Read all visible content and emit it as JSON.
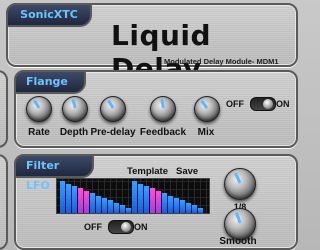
{
  "brand": "SonicXTC",
  "title": "Liquid Delay",
  "subtitle": "Modulated Delay Module- MDM1",
  "flange": {
    "tab_label": "Flange",
    "knobs": [
      {
        "label": "Rate"
      },
      {
        "label": "Depth"
      },
      {
        "label": "Pre-delay"
      },
      {
        "label": "Feedback"
      },
      {
        "label": "Mix"
      }
    ],
    "off_label": "OFF",
    "on_label": "ON",
    "toggle_state": "on"
  },
  "filter_lfo": {
    "tab_label": "Filter LFO",
    "template_label": "Template",
    "save_label": "Save",
    "rate_value": "1/8",
    "smooth_label": "Smooth",
    "off_label": "OFF",
    "on_label": "ON",
    "toggle_state": "on"
  },
  "colors": {
    "tab_text": "#6cc4ff",
    "indicator": "#5fb8ff",
    "step_blue": "#3aa0ff",
    "step_pink": "#ff4fd8"
  }
}
